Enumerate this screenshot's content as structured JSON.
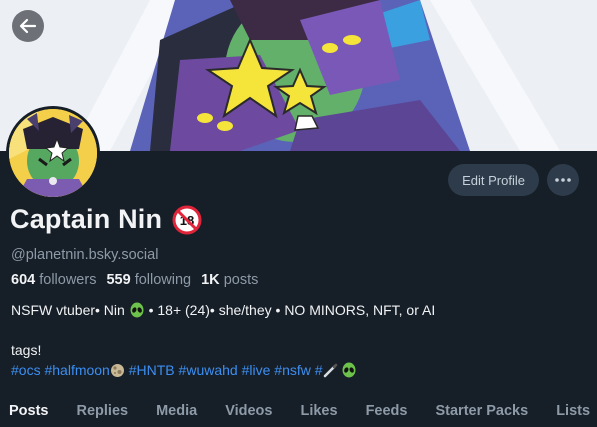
{
  "profile": {
    "display_name": "Captain Nin",
    "handle": "@planetnin.bsky.social",
    "followers_count": "604",
    "followers_label": "followers",
    "following_count": "559",
    "following_label": "following",
    "posts_count": "1K",
    "posts_label": "posts"
  },
  "bio": {
    "line1_a": "NSFW vtuber• Nin",
    "line1_b": "• 18+ (24)• she/they • NO MINORS, NFT, or AI",
    "line2": "tags!",
    "tags": [
      "#ocs",
      "#halfmoon",
      "#HNTB",
      "#wuwahd",
      "#live",
      "#nsfw",
      "#"
    ]
  },
  "actions": {
    "edit_profile": "Edit Profile"
  },
  "age_badge": "18",
  "tabs": [
    "Posts",
    "Replies",
    "Media",
    "Videos",
    "Likes",
    "Feeds",
    "Starter Packs",
    "Lists"
  ],
  "icons": {
    "back": "arrow-left-icon",
    "more": "ellipsis-icon",
    "alien": "alien-emoji-icon",
    "moon": "moon-emoji-icon",
    "pen": "pen-emoji-icon"
  },
  "colors": {
    "background": "#161e27",
    "button": "#2e3b4a",
    "link": "#3c8ff2",
    "muted_text": "#8d9aa8"
  }
}
